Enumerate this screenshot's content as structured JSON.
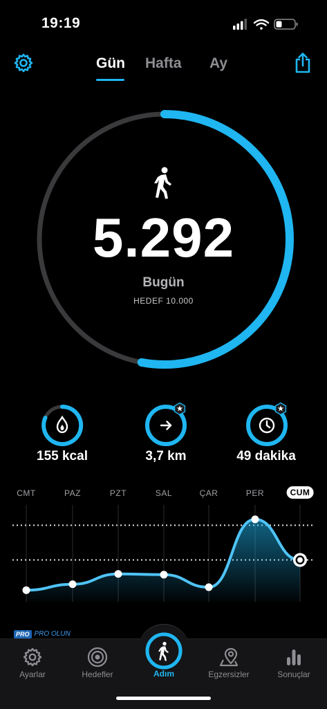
{
  "status_bar": {
    "time": "19:19"
  },
  "header": {
    "tabs": [
      {
        "label": "Gün",
        "active": true
      },
      {
        "label": "Hafta",
        "active": false
      },
      {
        "label": "Ay",
        "active": false
      }
    ]
  },
  "progress": {
    "steps": "5.292",
    "label": "Bugün",
    "goal_text": "HEDEF 10.000",
    "fraction": 0.5292
  },
  "stats": {
    "calories": {
      "value": "155 kcal",
      "icon": "flame-icon"
    },
    "distance": {
      "value": "3,7 km",
      "icon": "arrow-right-icon"
    },
    "duration": {
      "value": "49 dakika",
      "icon": "clock-icon"
    }
  },
  "chart_data": {
    "type": "area",
    "categories": [
      "CMT",
      "PAZ",
      "PZT",
      "SAL",
      "ÇAR",
      "PER",
      "CUM"
    ],
    "active_category": "CUM",
    "values": [
      1200,
      2000,
      3400,
      3300,
      1600,
      10800,
      5292
    ],
    "reference_lines": [
      10000,
      5292
    ],
    "ylim": [
      0,
      12000
    ]
  },
  "pro": {
    "tag": "PRO",
    "text": "PRO OLUN"
  },
  "tabbar": {
    "items": [
      {
        "label": "Ayarlar",
        "icon": "gear-icon"
      },
      {
        "label": "Hedefler",
        "icon": "target-icon"
      },
      {
        "label": "Adım",
        "icon": "walking-icon"
      },
      {
        "label": "Egzersizler",
        "icon": "map-pin-icon"
      },
      {
        "label": "Sonuçlar",
        "icon": "bar-chart-icon"
      }
    ]
  },
  "colors": {
    "accent": "#1fb6f1",
    "track": "#3a3a3c",
    "background": "#000000"
  }
}
